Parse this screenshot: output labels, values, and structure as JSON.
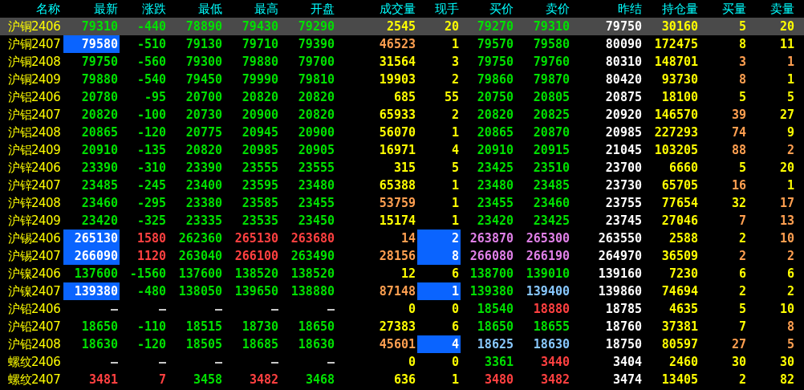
{
  "columns": [
    "名称",
    "最新",
    "涨跌",
    "最低",
    "最高",
    "开盘",
    "成交量",
    "现手",
    "买价",
    "卖价",
    "昨结",
    "持仓量",
    "买量",
    "卖量"
  ],
  "rows": [
    {
      "name": "沪铜2406",
      "selected": true,
      "cells": [
        {
          "text": "79310",
          "color": "#00e000",
          "flash": false
        },
        {
          "text": "-440",
          "color": "#00e000",
          "flash": false
        },
        {
          "text": "78890",
          "color": "#00e000",
          "flash": false
        },
        {
          "text": "79430",
          "color": "#00e000",
          "flash": false
        },
        {
          "text": "79290",
          "color": "#00e000",
          "flash": false
        },
        {
          "text": "2545",
          "color": "#ffff00",
          "flash": false
        },
        {
          "text": "20",
          "color": "#ffff00",
          "flash": false
        },
        {
          "text": "79270",
          "color": "#00e000",
          "flash": false
        },
        {
          "text": "79310",
          "color": "#00e000",
          "flash": false
        },
        {
          "text": "79750",
          "color": "#ffffff",
          "flash": false
        },
        {
          "text": "30160",
          "color": "#ffff00",
          "flash": false
        },
        {
          "text": "5",
          "color": "#ffff00",
          "flash": false
        },
        {
          "text": "20",
          "color": "#ffff00",
          "flash": false
        }
      ]
    },
    {
      "name": "沪铜2407",
      "selected": false,
      "cells": [
        {
          "text": "79580",
          "color": "#ffffff",
          "flash": true
        },
        {
          "text": "-510",
          "color": "#00e000",
          "flash": false
        },
        {
          "text": "79130",
          "color": "#00e000",
          "flash": false
        },
        {
          "text": "79710",
          "color": "#00e000",
          "flash": false
        },
        {
          "text": "79390",
          "color": "#00e000",
          "flash": false
        },
        {
          "text": "46523",
          "color": "#ff9f50",
          "flash": false
        },
        {
          "text": "1",
          "color": "#ffff00",
          "flash": false
        },
        {
          "text": "79570",
          "color": "#00e000",
          "flash": false
        },
        {
          "text": "79580",
          "color": "#00e000",
          "flash": false
        },
        {
          "text": "80090",
          "color": "#ffffff",
          "flash": false
        },
        {
          "text": "172475",
          "color": "#ffff00",
          "flash": false
        },
        {
          "text": "8",
          "color": "#ffff00",
          "flash": false
        },
        {
          "text": "11",
          "color": "#ffff00",
          "flash": false
        }
      ]
    },
    {
      "name": "沪铜2408",
      "selected": false,
      "cells": [
        {
          "text": "79750",
          "color": "#00e000",
          "flash": false
        },
        {
          "text": "-560",
          "color": "#00e000",
          "flash": false
        },
        {
          "text": "79300",
          "color": "#00e000",
          "flash": false
        },
        {
          "text": "79880",
          "color": "#00e000",
          "flash": false
        },
        {
          "text": "79700",
          "color": "#00e000",
          "flash": false
        },
        {
          "text": "31564",
          "color": "#ffff00",
          "flash": false
        },
        {
          "text": "3",
          "color": "#ffff00",
          "flash": false
        },
        {
          "text": "79750",
          "color": "#00e000",
          "flash": false
        },
        {
          "text": "79760",
          "color": "#00e000",
          "flash": false
        },
        {
          "text": "80310",
          "color": "#ffffff",
          "flash": false
        },
        {
          "text": "148701",
          "color": "#ffff00",
          "flash": false
        },
        {
          "text": "3",
          "color": "#ff9f50",
          "flash": false
        },
        {
          "text": "1",
          "color": "#ff9f50",
          "flash": false
        }
      ]
    },
    {
      "name": "沪铜2409",
      "selected": false,
      "cells": [
        {
          "text": "79880",
          "color": "#00e000",
          "flash": false
        },
        {
          "text": "-540",
          "color": "#00e000",
          "flash": false
        },
        {
          "text": "79450",
          "color": "#00e000",
          "flash": false
        },
        {
          "text": "79990",
          "color": "#00e000",
          "flash": false
        },
        {
          "text": "79810",
          "color": "#00e000",
          "flash": false
        },
        {
          "text": "19903",
          "color": "#ffff00",
          "flash": false
        },
        {
          "text": "2",
          "color": "#ffff00",
          "flash": false
        },
        {
          "text": "79860",
          "color": "#00e000",
          "flash": false
        },
        {
          "text": "79870",
          "color": "#00e000",
          "flash": false
        },
        {
          "text": "80420",
          "color": "#ffffff",
          "flash": false
        },
        {
          "text": "93730",
          "color": "#ffff00",
          "flash": false
        },
        {
          "text": "8",
          "color": "#ff9f50",
          "flash": false
        },
        {
          "text": "1",
          "color": "#ffff00",
          "flash": false
        }
      ]
    },
    {
      "name": "沪铝2406",
      "selected": false,
      "cells": [
        {
          "text": "20780",
          "color": "#00e000",
          "flash": false
        },
        {
          "text": "-95",
          "color": "#00e000",
          "flash": false
        },
        {
          "text": "20700",
          "color": "#00e000",
          "flash": false
        },
        {
          "text": "20820",
          "color": "#00e000",
          "flash": false
        },
        {
          "text": "20820",
          "color": "#00e000",
          "flash": false
        },
        {
          "text": "685",
          "color": "#ffff00",
          "flash": false
        },
        {
          "text": "55",
          "color": "#ffff00",
          "flash": false
        },
        {
          "text": "20750",
          "color": "#00e000",
          "flash": false
        },
        {
          "text": "20805",
          "color": "#00e000",
          "flash": false
        },
        {
          "text": "20875",
          "color": "#ffffff",
          "flash": false
        },
        {
          "text": "18100",
          "color": "#ffff00",
          "flash": false
        },
        {
          "text": "5",
          "color": "#ffff00",
          "flash": false
        },
        {
          "text": "5",
          "color": "#ffff00",
          "flash": false
        }
      ]
    },
    {
      "name": "沪铝2407",
      "selected": false,
      "cells": [
        {
          "text": "20820",
          "color": "#00e000",
          "flash": false
        },
        {
          "text": "-100",
          "color": "#00e000",
          "flash": false
        },
        {
          "text": "20730",
          "color": "#00e000",
          "flash": false
        },
        {
          "text": "20900",
          "color": "#00e000",
          "flash": false
        },
        {
          "text": "20820",
          "color": "#00e000",
          "flash": false
        },
        {
          "text": "65933",
          "color": "#ffff00",
          "flash": false
        },
        {
          "text": "2",
          "color": "#ffff00",
          "flash": false
        },
        {
          "text": "20820",
          "color": "#00e000",
          "flash": false
        },
        {
          "text": "20825",
          "color": "#00e000",
          "flash": false
        },
        {
          "text": "20920",
          "color": "#ffffff",
          "flash": false
        },
        {
          "text": "146570",
          "color": "#ffff00",
          "flash": false
        },
        {
          "text": "39",
          "color": "#ff9f50",
          "flash": false
        },
        {
          "text": "27",
          "color": "#ffff00",
          "flash": false
        }
      ]
    },
    {
      "name": "沪铝2408",
      "selected": false,
      "cells": [
        {
          "text": "20865",
          "color": "#00e000",
          "flash": false
        },
        {
          "text": "-120",
          "color": "#00e000",
          "flash": false
        },
        {
          "text": "20775",
          "color": "#00e000",
          "flash": false
        },
        {
          "text": "20945",
          "color": "#00e000",
          "flash": false
        },
        {
          "text": "20900",
          "color": "#00e000",
          "flash": false
        },
        {
          "text": "56070",
          "color": "#ffff00",
          "flash": false
        },
        {
          "text": "1",
          "color": "#ffff00",
          "flash": false
        },
        {
          "text": "20865",
          "color": "#00e000",
          "flash": false
        },
        {
          "text": "20870",
          "color": "#00e000",
          "flash": false
        },
        {
          "text": "20985",
          "color": "#ffffff",
          "flash": false
        },
        {
          "text": "227293",
          "color": "#ffff00",
          "flash": false
        },
        {
          "text": "74",
          "color": "#ff9f50",
          "flash": false
        },
        {
          "text": "9",
          "color": "#ffff00",
          "flash": false
        }
      ]
    },
    {
      "name": "沪铝2409",
      "selected": false,
      "cells": [
        {
          "text": "20910",
          "color": "#00e000",
          "flash": false
        },
        {
          "text": "-135",
          "color": "#00e000",
          "flash": false
        },
        {
          "text": "20820",
          "color": "#00e000",
          "flash": false
        },
        {
          "text": "20985",
          "color": "#00e000",
          "flash": false
        },
        {
          "text": "20905",
          "color": "#00e000",
          "flash": false
        },
        {
          "text": "16971",
          "color": "#ffff00",
          "flash": false
        },
        {
          "text": "4",
          "color": "#ffff00",
          "flash": false
        },
        {
          "text": "20910",
          "color": "#00e000",
          "flash": false
        },
        {
          "text": "20915",
          "color": "#00e000",
          "flash": false
        },
        {
          "text": "21045",
          "color": "#ffffff",
          "flash": false
        },
        {
          "text": "103205",
          "color": "#ffff00",
          "flash": false
        },
        {
          "text": "88",
          "color": "#ff9f50",
          "flash": false
        },
        {
          "text": "2",
          "color": "#ff9f50",
          "flash": false
        }
      ]
    },
    {
      "name": "沪锌2406",
      "selected": false,
      "cells": [
        {
          "text": "23390",
          "color": "#00e000",
          "flash": false
        },
        {
          "text": "-310",
          "color": "#00e000",
          "flash": false
        },
        {
          "text": "23390",
          "color": "#00e000",
          "flash": false
        },
        {
          "text": "23555",
          "color": "#00e000",
          "flash": false
        },
        {
          "text": "23555",
          "color": "#00e000",
          "flash": false
        },
        {
          "text": "315",
          "color": "#ffff00",
          "flash": false
        },
        {
          "text": "5",
          "color": "#ffff00",
          "flash": false
        },
        {
          "text": "23425",
          "color": "#00e000",
          "flash": false
        },
        {
          "text": "23510",
          "color": "#00e000",
          "flash": false
        },
        {
          "text": "23700",
          "color": "#ffffff",
          "flash": false
        },
        {
          "text": "6660",
          "color": "#ffff00",
          "flash": false
        },
        {
          "text": "5",
          "color": "#ffff00",
          "flash": false
        },
        {
          "text": "20",
          "color": "#ffff00",
          "flash": false
        }
      ]
    },
    {
      "name": "沪锌2407",
      "selected": false,
      "cells": [
        {
          "text": "23485",
          "color": "#00e000",
          "flash": false
        },
        {
          "text": "-245",
          "color": "#00e000",
          "flash": false
        },
        {
          "text": "23400",
          "color": "#00e000",
          "flash": false
        },
        {
          "text": "23595",
          "color": "#00e000",
          "flash": false
        },
        {
          "text": "23480",
          "color": "#00e000",
          "flash": false
        },
        {
          "text": "65388",
          "color": "#ffff00",
          "flash": false
        },
        {
          "text": "1",
          "color": "#ffff00",
          "flash": false
        },
        {
          "text": "23480",
          "color": "#00e000",
          "flash": false
        },
        {
          "text": "23485",
          "color": "#00e000",
          "flash": false
        },
        {
          "text": "23730",
          "color": "#ffffff",
          "flash": false
        },
        {
          "text": "65705",
          "color": "#ffff00",
          "flash": false
        },
        {
          "text": "16",
          "color": "#ff9f50",
          "flash": false
        },
        {
          "text": "1",
          "color": "#ffff00",
          "flash": false
        }
      ]
    },
    {
      "name": "沪锌2408",
      "selected": false,
      "cells": [
        {
          "text": "23460",
          "color": "#00e000",
          "flash": false
        },
        {
          "text": "-295",
          "color": "#00e000",
          "flash": false
        },
        {
          "text": "23380",
          "color": "#00e000",
          "flash": false
        },
        {
          "text": "23585",
          "color": "#00e000",
          "flash": false
        },
        {
          "text": "23455",
          "color": "#00e000",
          "flash": false
        },
        {
          "text": "53759",
          "color": "#ff9f50",
          "flash": false
        },
        {
          "text": "1",
          "color": "#ffff00",
          "flash": false
        },
        {
          "text": "23455",
          "color": "#00e000",
          "flash": false
        },
        {
          "text": "23460",
          "color": "#00e000",
          "flash": false
        },
        {
          "text": "23755",
          "color": "#ffffff",
          "flash": false
        },
        {
          "text": "77654",
          "color": "#ffff00",
          "flash": false
        },
        {
          "text": "32",
          "color": "#ffff00",
          "flash": false
        },
        {
          "text": "17",
          "color": "#ff9f50",
          "flash": false
        }
      ]
    },
    {
      "name": "沪锌2409",
      "selected": false,
      "cells": [
        {
          "text": "23420",
          "color": "#00e000",
          "flash": false
        },
        {
          "text": "-325",
          "color": "#00e000",
          "flash": false
        },
        {
          "text": "23335",
          "color": "#00e000",
          "flash": false
        },
        {
          "text": "23535",
          "color": "#00e000",
          "flash": false
        },
        {
          "text": "23450",
          "color": "#00e000",
          "flash": false
        },
        {
          "text": "15174",
          "color": "#ffff00",
          "flash": false
        },
        {
          "text": "1",
          "color": "#ffff00",
          "flash": false
        },
        {
          "text": "23420",
          "color": "#00e000",
          "flash": false
        },
        {
          "text": "23425",
          "color": "#00e000",
          "flash": false
        },
        {
          "text": "23745",
          "color": "#ffffff",
          "flash": false
        },
        {
          "text": "27046",
          "color": "#ffff00",
          "flash": false
        },
        {
          "text": "7",
          "color": "#ff9f50",
          "flash": false
        },
        {
          "text": "13",
          "color": "#ff9f50",
          "flash": false
        }
      ]
    },
    {
      "name": "沪锡2406",
      "selected": false,
      "cells": [
        {
          "text": "265130",
          "color": "#ffffff",
          "flash": true
        },
        {
          "text": "1580",
          "color": "#ff4040",
          "flash": false
        },
        {
          "text": "262360",
          "color": "#00e000",
          "flash": false
        },
        {
          "text": "265130",
          "color": "#ff4040",
          "flash": false
        },
        {
          "text": "263680",
          "color": "#ff4040",
          "flash": false
        },
        {
          "text": "14",
          "color": "#ff9f50",
          "flash": false
        },
        {
          "text": "2",
          "color": "#ffffff",
          "flash": true
        },
        {
          "text": "263870",
          "color": "#e080e8",
          "flash": false
        },
        {
          "text": "265300",
          "color": "#e080e8",
          "flash": false
        },
        {
          "text": "263550",
          "color": "#ffffff",
          "flash": false
        },
        {
          "text": "2588",
          "color": "#ffff00",
          "flash": false
        },
        {
          "text": "2",
          "color": "#ffff00",
          "flash": false
        },
        {
          "text": "10",
          "color": "#ff9f50",
          "flash": false
        }
      ]
    },
    {
      "name": "沪锡2407",
      "selected": false,
      "cells": [
        {
          "text": "266090",
          "color": "#ffffff",
          "flash": true
        },
        {
          "text": "1120",
          "color": "#ff4040",
          "flash": false
        },
        {
          "text": "263040",
          "color": "#00e000",
          "flash": false
        },
        {
          "text": "266100",
          "color": "#ff4040",
          "flash": false
        },
        {
          "text": "263490",
          "color": "#00e000",
          "flash": false
        },
        {
          "text": "28156",
          "color": "#ff9f50",
          "flash": false
        },
        {
          "text": "8",
          "color": "#ffffff",
          "flash": true
        },
        {
          "text": "266080",
          "color": "#e080e8",
          "flash": false
        },
        {
          "text": "266190",
          "color": "#e080e8",
          "flash": false
        },
        {
          "text": "264970",
          "color": "#ffffff",
          "flash": false
        },
        {
          "text": "36509",
          "color": "#ffff00",
          "flash": false
        },
        {
          "text": "2",
          "color": "#ff9f50",
          "flash": false
        },
        {
          "text": "2",
          "color": "#ff9f50",
          "flash": false
        }
      ]
    },
    {
      "name": "沪镍2406",
      "selected": false,
      "cells": [
        {
          "text": "137600",
          "color": "#00e000",
          "flash": false
        },
        {
          "text": "-1560",
          "color": "#00e000",
          "flash": false
        },
        {
          "text": "137600",
          "color": "#00e000",
          "flash": false
        },
        {
          "text": "138520",
          "color": "#00e000",
          "flash": false
        },
        {
          "text": "138520",
          "color": "#00e000",
          "flash": false
        },
        {
          "text": "12",
          "color": "#ffff00",
          "flash": false
        },
        {
          "text": "6",
          "color": "#ffff00",
          "flash": false
        },
        {
          "text": "138700",
          "color": "#00e000",
          "flash": false
        },
        {
          "text": "139010",
          "color": "#00e000",
          "flash": false
        },
        {
          "text": "139160",
          "color": "#ffffff",
          "flash": false
        },
        {
          "text": "7230",
          "color": "#ffff00",
          "flash": false
        },
        {
          "text": "6",
          "color": "#ffff00",
          "flash": false
        },
        {
          "text": "6",
          "color": "#ffff00",
          "flash": false
        }
      ]
    },
    {
      "name": "沪镍2407",
      "selected": false,
      "cells": [
        {
          "text": "139380",
          "color": "#ffffff",
          "flash": true
        },
        {
          "text": "-480",
          "color": "#00e000",
          "flash": false
        },
        {
          "text": "138050",
          "color": "#00e000",
          "flash": false
        },
        {
          "text": "139650",
          "color": "#00e000",
          "flash": false
        },
        {
          "text": "138880",
          "color": "#00e000",
          "flash": false
        },
        {
          "text": "87148",
          "color": "#ff9f50",
          "flash": false
        },
        {
          "text": "1",
          "color": "#ffffff",
          "flash": true
        },
        {
          "text": "139380",
          "color": "#00e000",
          "flash": false
        },
        {
          "text": "139400",
          "color": "#88c8ff",
          "flash": false
        },
        {
          "text": "139860",
          "color": "#ffffff",
          "flash": false
        },
        {
          "text": "74694",
          "color": "#ffff00",
          "flash": false
        },
        {
          "text": "2",
          "color": "#ffff00",
          "flash": false
        },
        {
          "text": "2",
          "color": "#ffff00",
          "flash": false
        }
      ]
    },
    {
      "name": "沪铅2406",
      "selected": false,
      "cells": [
        {
          "text": "—",
          "color": "#d0d0d0",
          "flash": false
        },
        {
          "text": "—",
          "color": "#d0d0d0",
          "flash": false
        },
        {
          "text": "—",
          "color": "#d0d0d0",
          "flash": false
        },
        {
          "text": "—",
          "color": "#d0d0d0",
          "flash": false
        },
        {
          "text": "—",
          "color": "#d0d0d0",
          "flash": false
        },
        {
          "text": "0",
          "color": "#ffff00",
          "flash": false
        },
        {
          "text": "0",
          "color": "#ffff00",
          "flash": false
        },
        {
          "text": "18540",
          "color": "#00e000",
          "flash": false
        },
        {
          "text": "18880",
          "color": "#ff4040",
          "flash": false
        },
        {
          "text": "18785",
          "color": "#ffffff",
          "flash": false
        },
        {
          "text": "4635",
          "color": "#ffff00",
          "flash": false
        },
        {
          "text": "5",
          "color": "#ffff00",
          "flash": false
        },
        {
          "text": "10",
          "color": "#ffff00",
          "flash": false
        }
      ]
    },
    {
      "name": "沪铅2407",
      "selected": false,
      "cells": [
        {
          "text": "18650",
          "color": "#00e000",
          "flash": false
        },
        {
          "text": "-110",
          "color": "#00e000",
          "flash": false
        },
        {
          "text": "18515",
          "color": "#00e000",
          "flash": false
        },
        {
          "text": "18730",
          "color": "#00e000",
          "flash": false
        },
        {
          "text": "18650",
          "color": "#00e000",
          "flash": false
        },
        {
          "text": "27383",
          "color": "#ffff00",
          "flash": false
        },
        {
          "text": "6",
          "color": "#ffff00",
          "flash": false
        },
        {
          "text": "18650",
          "color": "#00e000",
          "flash": false
        },
        {
          "text": "18655",
          "color": "#00e000",
          "flash": false
        },
        {
          "text": "18760",
          "color": "#ffffff",
          "flash": false
        },
        {
          "text": "37381",
          "color": "#ffff00",
          "flash": false
        },
        {
          "text": "7",
          "color": "#ffff00",
          "flash": false
        },
        {
          "text": "8",
          "color": "#ff9f50",
          "flash": false
        }
      ]
    },
    {
      "name": "沪铅2408",
      "selected": false,
      "cells": [
        {
          "text": "18630",
          "color": "#00e000",
          "flash": false
        },
        {
          "text": "-120",
          "color": "#00e000",
          "flash": false
        },
        {
          "text": "18505",
          "color": "#00e000",
          "flash": false
        },
        {
          "text": "18685",
          "color": "#00e000",
          "flash": false
        },
        {
          "text": "18630",
          "color": "#00e000",
          "flash": false
        },
        {
          "text": "45601",
          "color": "#ff9f50",
          "flash": false
        },
        {
          "text": "4",
          "color": "#ffffff",
          "flash": true
        },
        {
          "text": "18625",
          "color": "#88c8ff",
          "flash": false
        },
        {
          "text": "18630",
          "color": "#88c8ff",
          "flash": false
        },
        {
          "text": "18750",
          "color": "#ffffff",
          "flash": false
        },
        {
          "text": "80597",
          "color": "#ffff00",
          "flash": false
        },
        {
          "text": "27",
          "color": "#ff9f50",
          "flash": false
        },
        {
          "text": "5",
          "color": "#ff9f50",
          "flash": false
        }
      ]
    },
    {
      "name": "螺纹2406",
      "selected": false,
      "cells": [
        {
          "text": "—",
          "color": "#d0d0d0",
          "flash": false
        },
        {
          "text": "—",
          "color": "#d0d0d0",
          "flash": false
        },
        {
          "text": "—",
          "color": "#d0d0d0",
          "flash": false
        },
        {
          "text": "—",
          "color": "#d0d0d0",
          "flash": false
        },
        {
          "text": "—",
          "color": "#d0d0d0",
          "flash": false
        },
        {
          "text": "0",
          "color": "#ffff00",
          "flash": false
        },
        {
          "text": "0",
          "color": "#ffff00",
          "flash": false
        },
        {
          "text": "3361",
          "color": "#00e000",
          "flash": false
        },
        {
          "text": "3440",
          "color": "#ff4040",
          "flash": false
        },
        {
          "text": "3404",
          "color": "#ffffff",
          "flash": false
        },
        {
          "text": "2460",
          "color": "#ffff00",
          "flash": false
        },
        {
          "text": "30",
          "color": "#ffff00",
          "flash": false
        },
        {
          "text": "30",
          "color": "#ffff00",
          "flash": false
        }
      ]
    },
    {
      "name": "螺纹2407",
      "selected": false,
      "cells": [
        {
          "text": "3481",
          "color": "#ff4040",
          "flash": false
        },
        {
          "text": "7",
          "color": "#ff4040",
          "flash": false
        },
        {
          "text": "3458",
          "color": "#00e000",
          "flash": false
        },
        {
          "text": "3482",
          "color": "#ff4040",
          "flash": false
        },
        {
          "text": "3468",
          "color": "#00e000",
          "flash": false
        },
        {
          "text": "636",
          "color": "#ffff00",
          "flash": false
        },
        {
          "text": "1",
          "color": "#ffff00",
          "flash": false
        },
        {
          "text": "3480",
          "color": "#ff4040",
          "flash": false
        },
        {
          "text": "3482",
          "color": "#ff4040",
          "flash": false
        },
        {
          "text": "3474",
          "color": "#ffffff",
          "flash": false
        },
        {
          "text": "13405",
          "color": "#ffff00",
          "flash": false
        },
        {
          "text": "2",
          "color": "#ffff00",
          "flash": false
        },
        {
          "text": "82",
          "color": "#ffff00",
          "flash": false
        }
      ]
    }
  ]
}
